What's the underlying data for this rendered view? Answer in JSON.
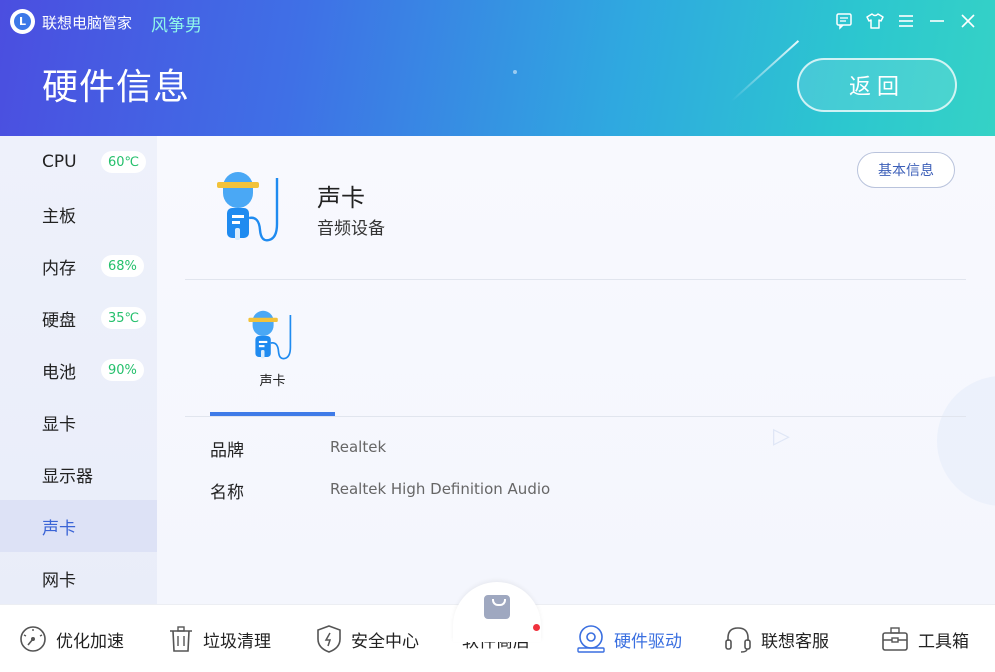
{
  "app": {
    "title": "联想电脑管家",
    "skin": "风筝男",
    "logo_letter": "L"
  },
  "window_controls": [
    "feedback-icon",
    "skin-icon",
    "menu-icon",
    "minimize-icon",
    "close-icon"
  ],
  "header": {
    "heading": "硬件信息",
    "back_label": "返回"
  },
  "sidebar": {
    "items": [
      {
        "label": "CPU",
        "badge": "60℃"
      },
      {
        "label": "主板",
        "badge": ""
      },
      {
        "label": "内存",
        "badge": "68%"
      },
      {
        "label": "硬盘",
        "badge": "35℃"
      },
      {
        "label": "电池",
        "badge": "90%"
      },
      {
        "label": "显卡",
        "badge": ""
      },
      {
        "label": "显示器",
        "badge": ""
      },
      {
        "label": "声卡",
        "badge": "",
        "active": true
      },
      {
        "label": "网卡",
        "badge": ""
      }
    ]
  },
  "device": {
    "name": "声卡",
    "subtitle": "音频设备",
    "basic_info_label": "基本信息",
    "tabs": [
      {
        "label": "声卡"
      }
    ],
    "info": [
      {
        "label": "品牌",
        "value": "Realtek"
      },
      {
        "label": "名称",
        "value": "Realtek High Definition Audio"
      }
    ]
  },
  "bottom_nav": [
    {
      "label": "优化加速",
      "icon": "speedometer-icon"
    },
    {
      "label": "垃圾清理",
      "icon": "trash-icon"
    },
    {
      "label": "安全中心",
      "icon": "shield-icon"
    },
    {
      "label": "软件商店",
      "icon": "shopping-bag-icon",
      "has_dot": true
    },
    {
      "label": "硬件驱动",
      "icon": "disk-icon",
      "active": true
    },
    {
      "label": "联想客服",
      "icon": "headset-icon"
    },
    {
      "label": "工具箱",
      "icon": "toolbox-icon"
    }
  ],
  "colors": {
    "accent": "#3a6fe0",
    "badge_green": "#25c06c",
    "notification_red": "#f0313d"
  }
}
